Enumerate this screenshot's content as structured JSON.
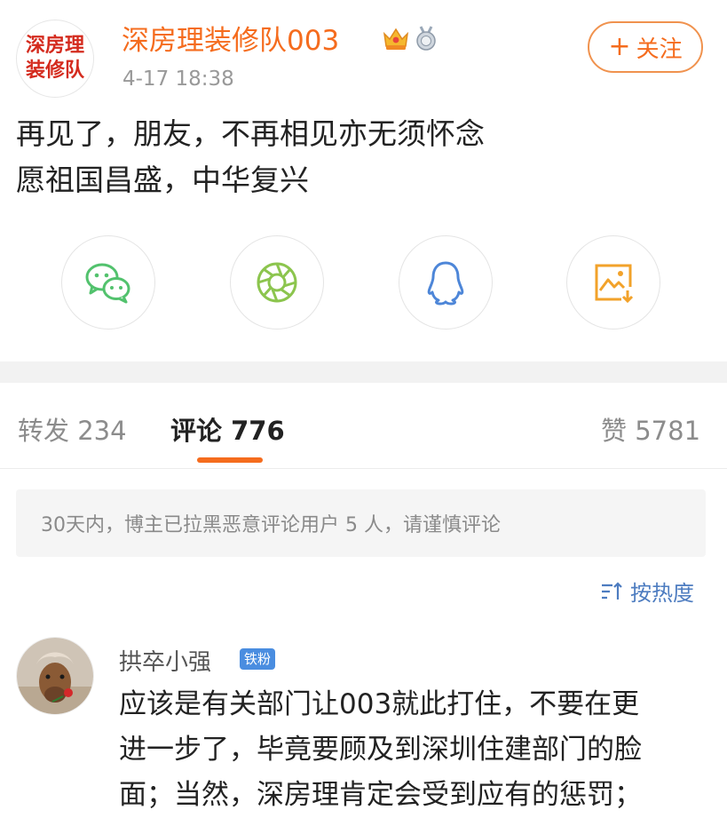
{
  "post": {
    "avatar_lines": [
      "深房理",
      "装修队"
    ],
    "username": "深房理装修队003",
    "badges": [
      "crown-badge-icon",
      "medal-badge-icon"
    ],
    "time": "4-17 18:38",
    "follow_plus": "+",
    "follow_label": "关注",
    "lines": [
      "再见了，朋友，不再相见亦无须怀念",
      "愿祖国昌盛，中华复兴"
    ]
  },
  "share": [
    "wechat-icon",
    "moments-icon",
    "qq-icon",
    "save-image-icon"
  ],
  "colors": {
    "accent": "#f56c1e",
    "link": "#4d7cc0",
    "wechat": "#52c26d",
    "moments": "#8cc54e",
    "qq": "#4d86d8",
    "save": "#f2a22a"
  },
  "tabs": {
    "repost": {
      "label": "转发",
      "count": "234"
    },
    "comment": {
      "label": "评论",
      "count": "776"
    },
    "like": {
      "label": "赞",
      "count": "5781"
    }
  },
  "notice": "30天内，博主已拉黑恶意评论用户 5 人，请谨慎评论",
  "sort_label": "按热度",
  "comments": [
    {
      "user": "拱卒小强",
      "badge": "铁粉",
      "lines": [
        "应该是有关部门让003就此打住，不要在更",
        "进一步了，毕竟要顾及到深圳住建部门的脸",
        "面；当然，深房理肯定会受到应有的惩罚；"
      ]
    }
  ]
}
